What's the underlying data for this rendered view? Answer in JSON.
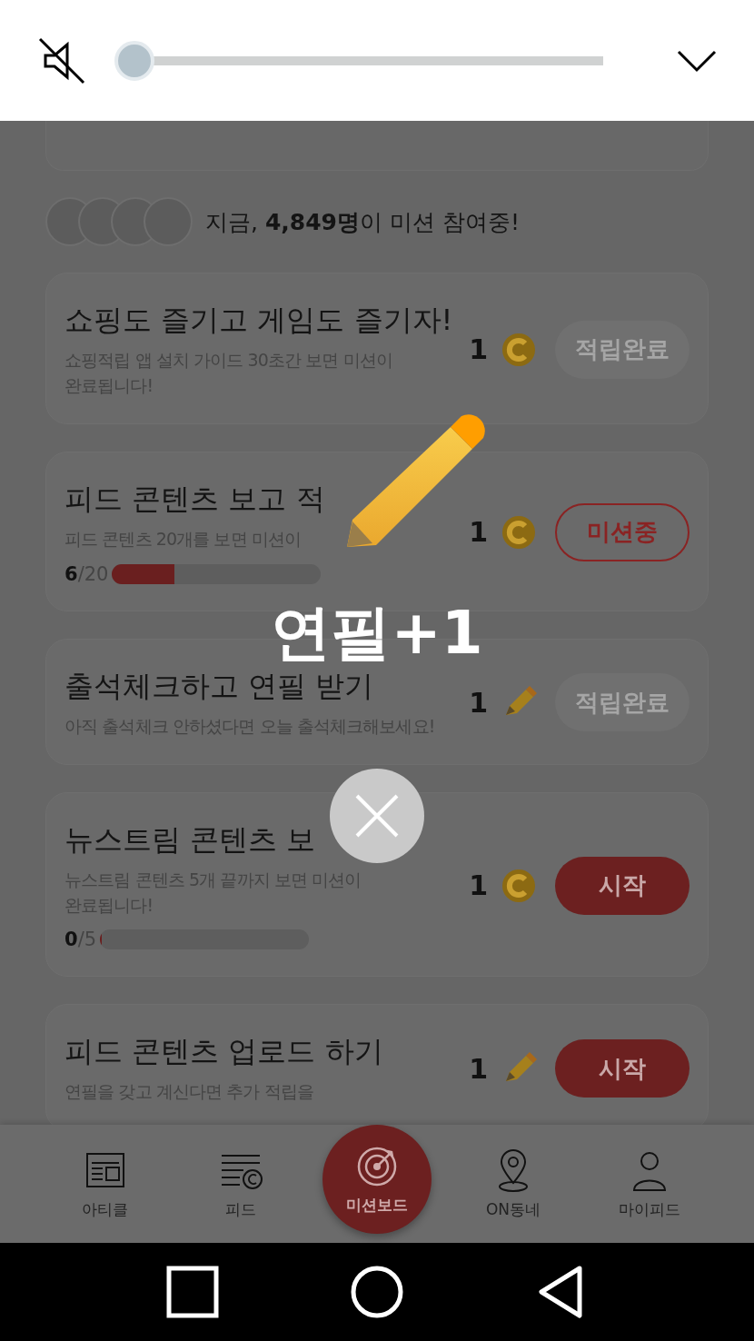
{
  "volume": {
    "muted": true,
    "level": 0
  },
  "participants": {
    "text": "지금, **4,849명**이 미션 참여중!"
  },
  "missions": [
    {
      "title": "쇼핑도 즐기고 게임도 즐기자!",
      "description": "쇼핑적립 앱 설치 가이드 30초간 보면 미션이\n완료됩니다!",
      "amount": "1",
      "kind": "coin",
      "button": {
        "label": "적립완료",
        "kind": "done"
      }
    },
    {
      "title": "피드 콘텐츠 보고 적",
      "description": "피드 콘텐츠 20개를 보면 미션이",
      "progress": {
        "text": "**6**/20",
        "level": 0.3
      },
      "amount": "1",
      "kind": "coin",
      "button": {
        "label": "미션중",
        "kind": "active"
      }
    },
    {
      "title": "출석체크하고 연필 받기",
      "description": "아직 출석체크 안하셨다면 오늘 출석체크해보세요!",
      "amount": "1",
      "kind": "pencil",
      "button": {
        "label": "적립완료",
        "kind": "done"
      }
    },
    {
      "title": "뉴스트림 콘텐츠 보",
      "description": "뉴스트림 콘텐츠 5개 끝까지 보면 미션이\n완료됩니다!",
      "progress": {
        "text": "**0**/5",
        "level": 0
      },
      "amount": "1",
      "kind": "coin",
      "button": {
        "label": "시작",
        "kind": "start"
      }
    },
    {
      "title": "피드 콘텐츠 업로드 하기",
      "description": "연필을 갖고 계신다면 추가 적립을",
      "amount": "1",
      "kind": "pencil",
      "button": {
        "label": "시작",
        "kind": "start"
      }
    }
  ],
  "popup": {
    "text": "연필+1"
  },
  "nav": [
    {
      "label": "아티클",
      "selected": false
    },
    {
      "label": "피드",
      "selected": false
    },
    {
      "label": "미션보드",
      "selected": true
    },
    {
      "label": "ON동네",
      "selected": false
    },
    {
      "label": "마이피드",
      "selected": false
    }
  ]
}
